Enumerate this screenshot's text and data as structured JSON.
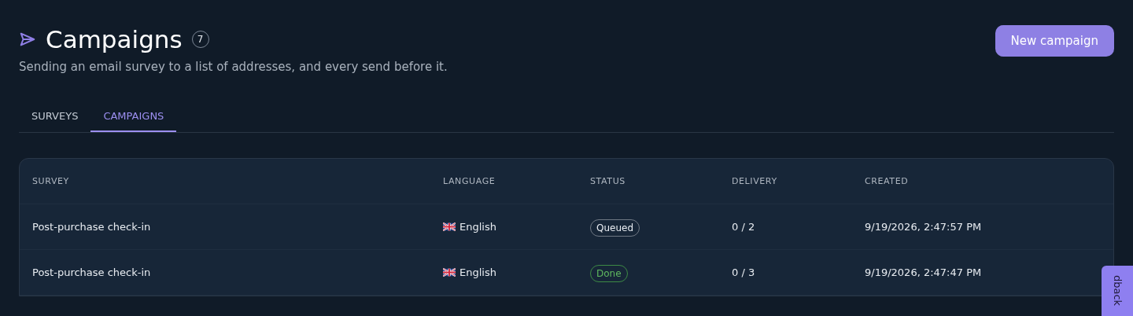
{
  "header": {
    "title": "Campaigns",
    "count": "7",
    "subtitle": "Sending an email survey to a list of addresses, and every send before it.",
    "button": "New campaign"
  },
  "tabs": [
    {
      "label": "SURVEYS",
      "selected": false
    },
    {
      "label": "CAMPAIGNS",
      "selected": true
    }
  ],
  "table": {
    "columns": [
      "SURVEY",
      "LANGUAGE",
      "STATUS",
      "DELIVERY",
      "CREATED"
    ],
    "rows": [
      {
        "survey": "Post-purchase check-in",
        "language": "English",
        "status": "Queued",
        "kind": "queued",
        "delivery": "0 / 2",
        "created": "9/19/2026, 2:47:57 PM"
      },
      {
        "survey": "Post-purchase check-in",
        "language": "English",
        "status": "Done",
        "kind": "done",
        "delivery": "0 / 3",
        "created": "9/19/2026, 2:47:47 PM"
      }
    ]
  },
  "feedback_tab": "dback"
}
